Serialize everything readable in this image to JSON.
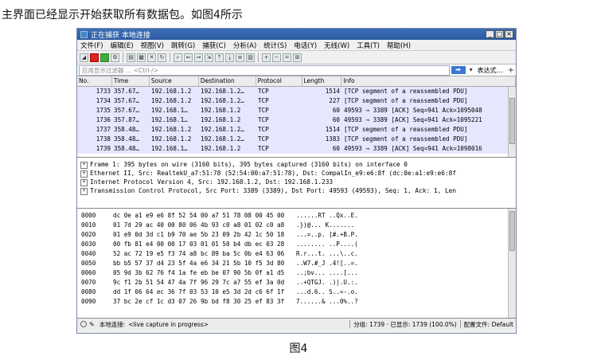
{
  "captions": {
    "top": "主界面已经显示开始获取所有数据包。如图4所示",
    "bottom": "图4"
  },
  "window": {
    "title": "正在捕获 本地连接",
    "buttons": {
      "minimize": "_",
      "maximize": "□",
      "close": "×"
    }
  },
  "menu": [
    "文件(F)",
    "编辑(E)",
    "视图(V)",
    "跳转(G)",
    "捕获(C)",
    "分析(A)",
    "统计(S)",
    "电话(Y)",
    "无线(W)",
    "工具(T)",
    "帮助(H)"
  ],
  "filter": {
    "placeholder": "应用显示过滤器 … <Ctrl-/>",
    "expression_label": "表达式…",
    "plus": "+"
  },
  "packet_list": {
    "columns": [
      "No.",
      "Time",
      "Source",
      "Destination",
      "Protocol",
      "Length",
      "Info"
    ],
    "rows": [
      {
        "no": "1733",
        "time": "357.67…",
        "src": "192.168.1.2",
        "dst": "192.168.1.2…",
        "proto": "TCP",
        "len": "1514",
        "info": "[TCP segment of a reassembled PDU]"
      },
      {
        "no": "1734",
        "time": "357.67…",
        "src": "192.168.1.2",
        "dst": "192.168.1.2…",
        "proto": "TCP",
        "len": "227",
        "info": "[TCP segment of a reassembled PDU]"
      },
      {
        "no": "1735",
        "time": "357.67…",
        "src": "192.168.1…",
        "dst": "192.168.1.2",
        "proto": "TCP",
        "len": "60",
        "info": "49593 → 3389 [ACK] Seq=941 Ack=1095048"
      },
      {
        "no": "1736",
        "time": "357.87…",
        "src": "192.168.1…",
        "dst": "192.168.1.2",
        "proto": "TCP",
        "len": "60",
        "info": "49593 → 3389 [ACK] Seq=941 Ack=1095221"
      },
      {
        "no": "1737",
        "time": "358.48…",
        "src": "192.168.1.2",
        "dst": "192.168.1.2…",
        "proto": "TCP",
        "len": "1514",
        "info": "[TCP segment of a reassembled PDU]"
      },
      {
        "no": "1738",
        "time": "358.48…",
        "src": "192.168.1.2",
        "dst": "192.168.1.2…",
        "proto": "TCP",
        "len": "1383",
        "info": "[TCP segment of a reassembled PDU]"
      },
      {
        "no": "1739",
        "time": "358.48…",
        "src": "192.168.1…",
        "dst": "192.168.1.2",
        "proto": "TCP",
        "len": "60",
        "info": "49593 → 3389 [ACK] Seq=941 Ack=1098016"
      }
    ]
  },
  "details": [
    "Frame 1: 395 bytes on wire (3160 bits), 395 bytes captured (3160 bits) on interface 0",
    "Ethernet II, Src: RealtekU_a7:51:78 (52:54:00:a7:51:78), Dst: CompalIn_e9:e6:8f (dc:0e:a1:e9:e6:8f",
    "Internet Protocol Version 4, Src: 192.168.1.2, Dst: 192.168.1.233",
    "Transmission Control Protocol, Src Port: 3389 (3389), Dst Port: 49593 (49593), Seq: 1, Ack: 1, Len"
  ],
  "hex": [
    {
      "off": "0000",
      "b1": "dc 0e a1 e9 e6 8f 52 54",
      "b2": "00 a7 51 78 08 00 45 00",
      "asc": "......RT ..Qx..E."
    },
    {
      "off": "0010",
      "b1": "01 7d 29 ac 40 00 80 06",
      "b2": "4b 93 c0 a8 01 02 c0 a8",
      "asc": ".})@... K......."
    },
    {
      "off": "0020",
      "b1": "01 e9 0d 3d c1 b9 70 ae",
      "b2": "5b 23 09 2b 42 1c 50 18",
      "asc": "...=..p. [#.+B.P."
    },
    {
      "off": "0030",
      "b1": "00 fb 81 e4 00 00 17 03",
      "b2": "01 01 50 b4 db ec 03 28",
      "asc": "........ ..P....("
    },
    {
      "off": "0040",
      "b1": "52 ac 72 19 e5 f3 74 a8",
      "b2": "bc 89 ba 5c 0b e4 63 06",
      "asc": "R.r...t. ...\\..c."
    },
    {
      "off": "0050",
      "b1": "bb b5 57 37 d4 23 5f 4a",
      "b2": "e6 34 21 5b 10 f5 3d 80",
      "asc": "..W7.#_J .4![..=."
    },
    {
      "off": "0060",
      "b1": "05 9d 3b 62 76 f4 1a fe",
      "b2": "eb be 07 90 5b 0f a1 d5",
      "asc": "..;bv... ....[..."
    },
    {
      "off": "0070",
      "b1": "9c f1 2b 51 54 47 4a 7f",
      "b2": "96 29 7c a7 55 ef 3a 0d",
      "asc": "..+QTGJ. .)|.U.:."
    },
    {
      "off": "0080",
      "b1": "dd 1f 06 64 ec 36 7f 03",
      "b2": "53 10 e5 3d 2d c6 6f 1f",
      "asc": "...d.6.. S..=-.o."
    },
    {
      "off": "0090",
      "b1": "37 bc 2e cf 1c d3 07 26",
      "b2": "9b bd f8 30 25 ef 83 3f",
      "asc": "7......& ...0%..?"
    }
  ],
  "status": {
    "interface": "本地连接:",
    "capture": "<live capture in progress>",
    "packets": "分组: 1739 · 已显示: 1739 (100.0%)",
    "profile": "配置文件: Default"
  }
}
